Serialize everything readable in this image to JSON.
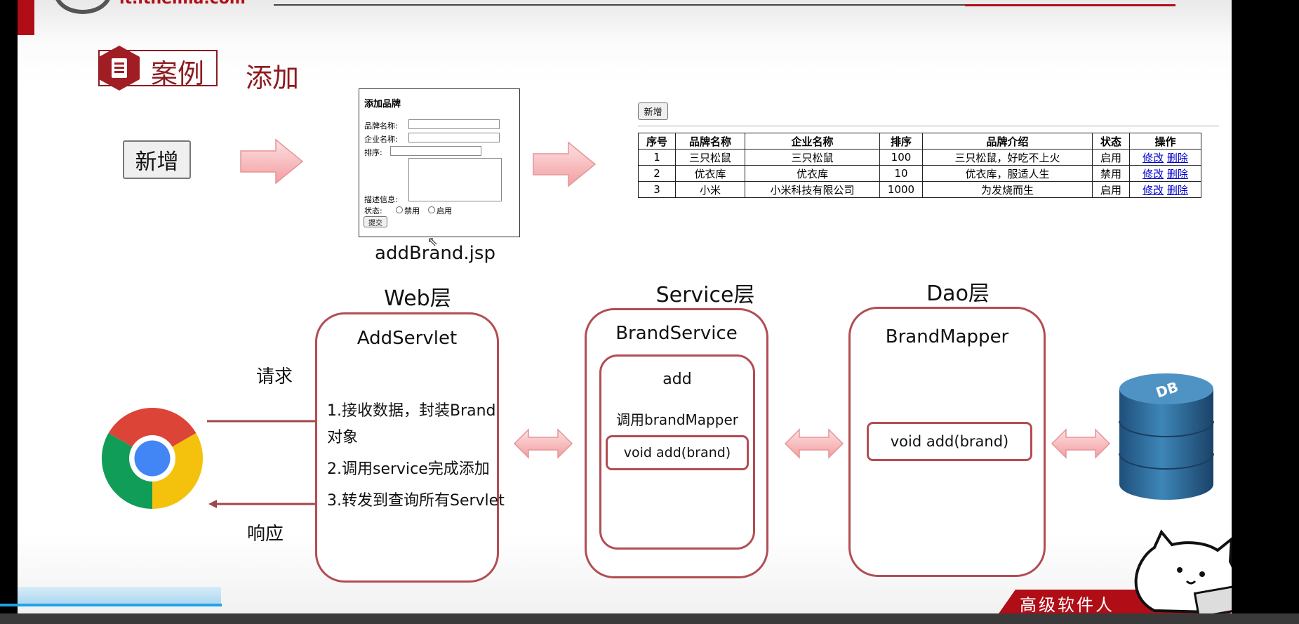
{
  "header": {
    "site_text": "it.itheima.com"
  },
  "section": {
    "badge_label": "案例",
    "title": "添加"
  },
  "add_button_label": "新增",
  "form": {
    "title": "添加品牌",
    "brand_name_label": "品牌名称:",
    "company_name_label": "企业名称:",
    "order_label": "排序:",
    "description_label": "描述信息:",
    "status_label": "状态:",
    "status_options": [
      "禁用",
      "启用"
    ],
    "submit_label": "提交",
    "caption": "addBrand.jsp"
  },
  "list": {
    "add_button_label": "新增",
    "columns": [
      "序号",
      "品牌名称",
      "企业名称",
      "排序",
      "品牌介绍",
      "状态",
      "操作"
    ],
    "rows": [
      {
        "id": "1",
        "brand": "三只松鼠",
        "company": "三只松鼠",
        "order": "100",
        "desc": "三只松鼠，好吃不上火",
        "status": "启用",
        "edit": "修改",
        "delete": "删除"
      },
      {
        "id": "2",
        "brand": "优衣库",
        "company": "优衣库",
        "order": "10",
        "desc": "优衣库，服适人生",
        "status": "禁用",
        "edit": "修改",
        "delete": "删除"
      },
      {
        "id": "3",
        "brand": "小米",
        "company": "小米科技有限公司",
        "order": "1000",
        "desc": "为发烧而生",
        "status": "启用",
        "edit": "修改",
        "delete": "删除"
      }
    ]
  },
  "diagram": {
    "request_label": "请求",
    "response_label": "响应",
    "web_layer": {
      "title": "Web层",
      "servlet": "AddServlet",
      "steps": [
        "1.接收数据，封装Brand",
        "对象",
        "2.调用service完成添加",
        "3.转发到查询所有Servlet"
      ]
    },
    "service_layer": {
      "title": "Service层",
      "class_name": "BrandService",
      "method": "add",
      "call_text": "调用brandMapper",
      "call_method": "void add(brand)"
    },
    "dao_layer": {
      "title": "Dao层",
      "class_name": "BrandMapper",
      "method": "void add(brand)"
    },
    "db_label": "DB"
  },
  "footer": {
    "banner_text": "高级软件人"
  },
  "colors": {
    "accent": "#8e1b20",
    "border": "#b24d53",
    "arrow_fill": "#f7b9bb",
    "link": "#0000cc"
  }
}
